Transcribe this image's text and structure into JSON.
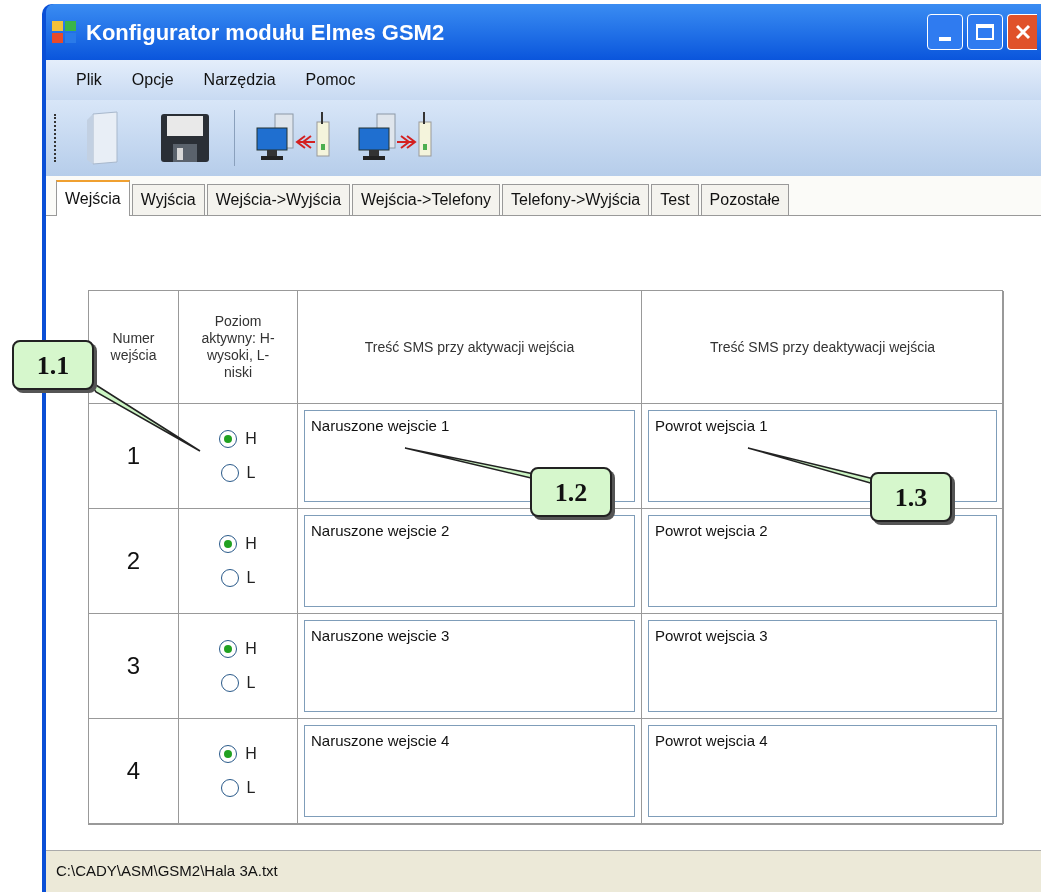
{
  "window": {
    "title": "Konfigurator modułu Elmes GSM2"
  },
  "menu": [
    "Plik",
    "Opcje",
    "Narzędzia",
    "Pomoc"
  ],
  "toolbar": [
    {
      "kind": "open"
    },
    {
      "kind": "save"
    },
    {
      "kind": "read"
    },
    {
      "kind": "write"
    }
  ],
  "tabs": [
    {
      "label": "Wejścia",
      "selected": true
    },
    {
      "label": "Wyjścia",
      "selected": false
    },
    {
      "label": "Wejścia->Wyjścia",
      "selected": false
    },
    {
      "label": "Wejścia->Telefony",
      "selected": false
    },
    {
      "label": "Telefony->Wyjścia",
      "selected": false
    },
    {
      "label": "Test",
      "selected": false
    },
    {
      "label": "Pozostałe",
      "selected": false
    }
  ],
  "table": {
    "columns": [
      "Numer wejścia",
      "Poziom aktywny: H-wysoki, L-niski",
      "Treść SMS przy aktywacji wejścia",
      "Treść SMS przy deaktywacji wejścia"
    ],
    "rows": [
      {
        "number": "1",
        "levels": [
          {
            "label": "H",
            "selected": true
          },
          {
            "label": "L",
            "selected": false
          }
        ],
        "activation_sms": "Naruszone wejscie 1",
        "deactivation_sms": "Powrot wejscia 1"
      },
      {
        "number": "2",
        "levels": [
          {
            "label": "H",
            "selected": true
          },
          {
            "label": "L",
            "selected": false
          }
        ],
        "activation_sms": "Naruszone wejscie 2",
        "deactivation_sms": "Powrot wejscia 2"
      },
      {
        "number": "3",
        "levels": [
          {
            "label": "H",
            "selected": true
          },
          {
            "label": "L",
            "selected": false
          }
        ],
        "activation_sms": "Naruszone wejscie 3",
        "deactivation_sms": "Powrot wejscia 3"
      },
      {
        "number": "4",
        "levels": [
          {
            "label": "H",
            "selected": true
          },
          {
            "label": "L",
            "selected": false
          }
        ],
        "activation_sms": "Naruszone wejscie 4",
        "deactivation_sms": "Powrot wejscia 4"
      }
    ]
  },
  "callouts": [
    {
      "label": "1.1"
    },
    {
      "label": "1.2"
    },
    {
      "label": "1.3"
    }
  ],
  "status_bar": {
    "path": "C:\\CADY\\ASM\\GSM2\\Hala 3A.txt"
  }
}
